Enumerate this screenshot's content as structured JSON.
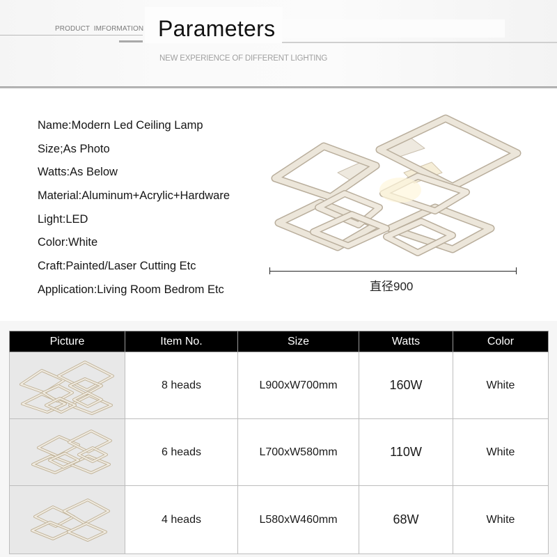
{
  "header": {
    "kicker": "PRODUCT  IMFORMATION",
    "title": "Parameters",
    "subtitle": "NEW EXPERIENCE OF DIFFERENT LIGHTING"
  },
  "specs": [
    "Name:Modern Led Ceiling Lamp",
    "Size;As Photo",
    "Watts:As Below",
    "Material:Aluminum+Acrylic+Hardware",
    "Light:LED",
    "Color:White",
    "Craft:Painted/Laser Cutting Etc",
    "Application:Living Room Bedrom Etc"
  ],
  "product_image": {
    "icon": "ceiling-lamp-8-heads",
    "dimension_label": "直径900"
  },
  "table": {
    "columns": [
      "Picture",
      "Item No.",
      "Size",
      "Watts",
      "Color"
    ],
    "rows": [
      {
        "picture": "ceiling-lamp-8-heads",
        "item": "8 heads",
        "size": "L900xW700mm",
        "watts": "160W",
        "color": "White"
      },
      {
        "picture": "ceiling-lamp-6-heads",
        "item": "6 heads",
        "size": "L700xW580mm",
        "watts": "110W",
        "color": "White"
      },
      {
        "picture": "ceiling-lamp-4-heads",
        "item": "4 heads",
        "size": "L580xW460mm",
        "watts": "68W",
        "color": "White"
      }
    ]
  },
  "colors": {
    "table_header_bg": "#000000",
    "table_header_text": "#ffffff",
    "picture_cell_bg": "#e8e8e8",
    "lamp_frame": "#e9e2d6",
    "lamp_edge": "#b9ae9c"
  }
}
